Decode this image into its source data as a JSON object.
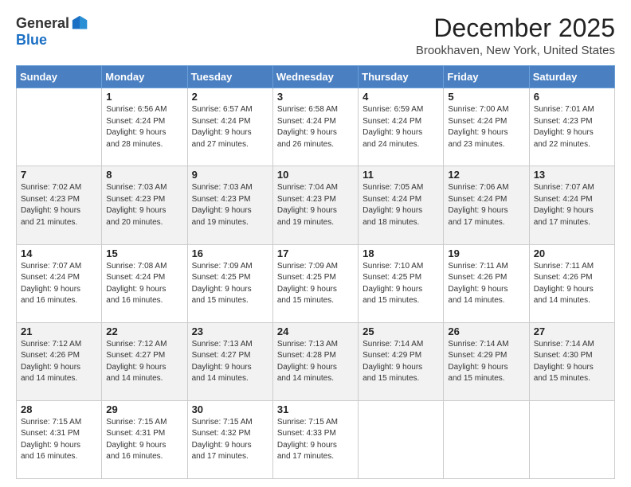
{
  "logo": {
    "general": "General",
    "blue": "Blue"
  },
  "title": "December 2025",
  "location": "Brookhaven, New York, United States",
  "weekdays": [
    "Sunday",
    "Monday",
    "Tuesday",
    "Wednesday",
    "Thursday",
    "Friday",
    "Saturday"
  ],
  "weeks": [
    [
      {
        "day": "",
        "sunrise": "",
        "sunset": "",
        "daylight": ""
      },
      {
        "day": "1",
        "sunrise": "Sunrise: 6:56 AM",
        "sunset": "Sunset: 4:24 PM",
        "daylight": "Daylight: 9 hours and 28 minutes."
      },
      {
        "day": "2",
        "sunrise": "Sunrise: 6:57 AM",
        "sunset": "Sunset: 4:24 PM",
        "daylight": "Daylight: 9 hours and 27 minutes."
      },
      {
        "day": "3",
        "sunrise": "Sunrise: 6:58 AM",
        "sunset": "Sunset: 4:24 PM",
        "daylight": "Daylight: 9 hours and 26 minutes."
      },
      {
        "day": "4",
        "sunrise": "Sunrise: 6:59 AM",
        "sunset": "Sunset: 4:24 PM",
        "daylight": "Daylight: 9 hours and 24 minutes."
      },
      {
        "day": "5",
        "sunrise": "Sunrise: 7:00 AM",
        "sunset": "Sunset: 4:24 PM",
        "daylight": "Daylight: 9 hours and 23 minutes."
      },
      {
        "day": "6",
        "sunrise": "Sunrise: 7:01 AM",
        "sunset": "Sunset: 4:23 PM",
        "daylight": "Daylight: 9 hours and 22 minutes."
      }
    ],
    [
      {
        "day": "7",
        "sunrise": "Sunrise: 7:02 AM",
        "sunset": "Sunset: 4:23 PM",
        "daylight": "Daylight: 9 hours and 21 minutes."
      },
      {
        "day": "8",
        "sunrise": "Sunrise: 7:03 AM",
        "sunset": "Sunset: 4:23 PM",
        "daylight": "Daylight: 9 hours and 20 minutes."
      },
      {
        "day": "9",
        "sunrise": "Sunrise: 7:03 AM",
        "sunset": "Sunset: 4:23 PM",
        "daylight": "Daylight: 9 hours and 19 minutes."
      },
      {
        "day": "10",
        "sunrise": "Sunrise: 7:04 AM",
        "sunset": "Sunset: 4:23 PM",
        "daylight": "Daylight: 9 hours and 19 minutes."
      },
      {
        "day": "11",
        "sunrise": "Sunrise: 7:05 AM",
        "sunset": "Sunset: 4:24 PM",
        "daylight": "Daylight: 9 hours and 18 minutes."
      },
      {
        "day": "12",
        "sunrise": "Sunrise: 7:06 AM",
        "sunset": "Sunset: 4:24 PM",
        "daylight": "Daylight: 9 hours and 17 minutes."
      },
      {
        "day": "13",
        "sunrise": "Sunrise: 7:07 AM",
        "sunset": "Sunset: 4:24 PM",
        "daylight": "Daylight: 9 hours and 17 minutes."
      }
    ],
    [
      {
        "day": "14",
        "sunrise": "Sunrise: 7:07 AM",
        "sunset": "Sunset: 4:24 PM",
        "daylight": "Daylight: 9 hours and 16 minutes."
      },
      {
        "day": "15",
        "sunrise": "Sunrise: 7:08 AM",
        "sunset": "Sunset: 4:24 PM",
        "daylight": "Daylight: 9 hours and 16 minutes."
      },
      {
        "day": "16",
        "sunrise": "Sunrise: 7:09 AM",
        "sunset": "Sunset: 4:25 PM",
        "daylight": "Daylight: 9 hours and 15 minutes."
      },
      {
        "day": "17",
        "sunrise": "Sunrise: 7:09 AM",
        "sunset": "Sunset: 4:25 PM",
        "daylight": "Daylight: 9 hours and 15 minutes."
      },
      {
        "day": "18",
        "sunrise": "Sunrise: 7:10 AM",
        "sunset": "Sunset: 4:25 PM",
        "daylight": "Daylight: 9 hours and 15 minutes."
      },
      {
        "day": "19",
        "sunrise": "Sunrise: 7:11 AM",
        "sunset": "Sunset: 4:26 PM",
        "daylight": "Daylight: 9 hours and 14 minutes."
      },
      {
        "day": "20",
        "sunrise": "Sunrise: 7:11 AM",
        "sunset": "Sunset: 4:26 PM",
        "daylight": "Daylight: 9 hours and 14 minutes."
      }
    ],
    [
      {
        "day": "21",
        "sunrise": "Sunrise: 7:12 AM",
        "sunset": "Sunset: 4:26 PM",
        "daylight": "Daylight: 9 hours and 14 minutes."
      },
      {
        "day": "22",
        "sunrise": "Sunrise: 7:12 AM",
        "sunset": "Sunset: 4:27 PM",
        "daylight": "Daylight: 9 hours and 14 minutes."
      },
      {
        "day": "23",
        "sunrise": "Sunrise: 7:13 AM",
        "sunset": "Sunset: 4:27 PM",
        "daylight": "Daylight: 9 hours and 14 minutes."
      },
      {
        "day": "24",
        "sunrise": "Sunrise: 7:13 AM",
        "sunset": "Sunset: 4:28 PM",
        "daylight": "Daylight: 9 hours and 14 minutes."
      },
      {
        "day": "25",
        "sunrise": "Sunrise: 7:14 AM",
        "sunset": "Sunset: 4:29 PM",
        "daylight": "Daylight: 9 hours and 15 minutes."
      },
      {
        "day": "26",
        "sunrise": "Sunrise: 7:14 AM",
        "sunset": "Sunset: 4:29 PM",
        "daylight": "Daylight: 9 hours and 15 minutes."
      },
      {
        "day": "27",
        "sunrise": "Sunrise: 7:14 AM",
        "sunset": "Sunset: 4:30 PM",
        "daylight": "Daylight: 9 hours and 15 minutes."
      }
    ],
    [
      {
        "day": "28",
        "sunrise": "Sunrise: 7:15 AM",
        "sunset": "Sunset: 4:31 PM",
        "daylight": "Daylight: 9 hours and 16 minutes."
      },
      {
        "day": "29",
        "sunrise": "Sunrise: 7:15 AM",
        "sunset": "Sunset: 4:31 PM",
        "daylight": "Daylight: 9 hours and 16 minutes."
      },
      {
        "day": "30",
        "sunrise": "Sunrise: 7:15 AM",
        "sunset": "Sunset: 4:32 PM",
        "daylight": "Daylight: 9 hours and 17 minutes."
      },
      {
        "day": "31",
        "sunrise": "Sunrise: 7:15 AM",
        "sunset": "Sunset: 4:33 PM",
        "daylight": "Daylight: 9 hours and 17 minutes."
      },
      {
        "day": "",
        "sunrise": "",
        "sunset": "",
        "daylight": ""
      },
      {
        "day": "",
        "sunrise": "",
        "sunset": "",
        "daylight": ""
      },
      {
        "day": "",
        "sunrise": "",
        "sunset": "",
        "daylight": ""
      }
    ]
  ]
}
